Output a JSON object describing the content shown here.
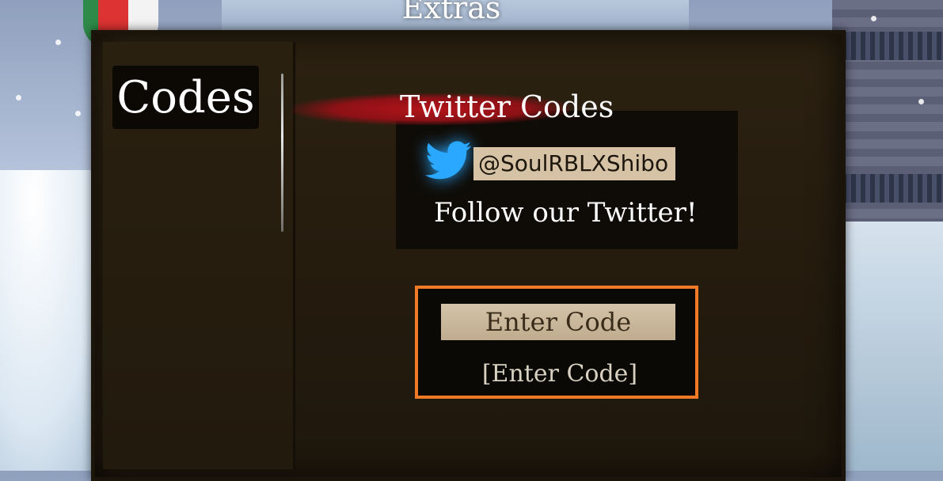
{
  "header": {
    "title": "Extras"
  },
  "sidebar": {
    "tabs": [
      {
        "label": "Codes",
        "active": true
      }
    ]
  },
  "twitter": {
    "heading": "Twitter Codes",
    "handle": "@SoulRBLXShibo",
    "follow_text": "Follow our Twitter!",
    "icon": "twitter-bird-icon"
  },
  "code_entry": {
    "button_label": "Enter Code",
    "input_placeholder": "[Enter Code]",
    "highlight_color": "#f07a26"
  },
  "colors": {
    "panel": "#241b0e",
    "brush_red": "#b3141a",
    "twitter_blue": "#2aa7ff",
    "parchment": "#d6c3a6"
  }
}
